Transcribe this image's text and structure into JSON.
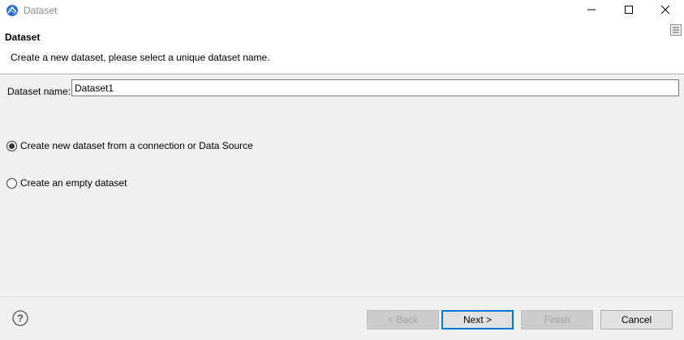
{
  "window": {
    "title": "Dataset",
    "icons": {
      "app": "eclipse-birt-icon",
      "minimize": "minimize-icon",
      "maximize": "maximize-icon",
      "close": "close-icon"
    }
  },
  "header": {
    "title": "Dataset",
    "description": "Create a new dataset, please select a unique dataset name.",
    "menu_icon": "view-menu-icon"
  },
  "form": {
    "name_label": "Dataset name:",
    "name_value": "Dataset1",
    "options": [
      {
        "label": "Create new dataset from a connection or Data Source",
        "selected": true
      },
      {
        "label": "Create an empty dataset",
        "selected": false
      }
    ]
  },
  "footer": {
    "help_icon": "help-icon",
    "back_label": "< Back",
    "next_label": "Next >",
    "finish_label": "Finish",
    "cancel_label": "Cancel"
  },
  "colors": {
    "accent": "#0078d7",
    "app_icon": "#2a6fcf"
  }
}
